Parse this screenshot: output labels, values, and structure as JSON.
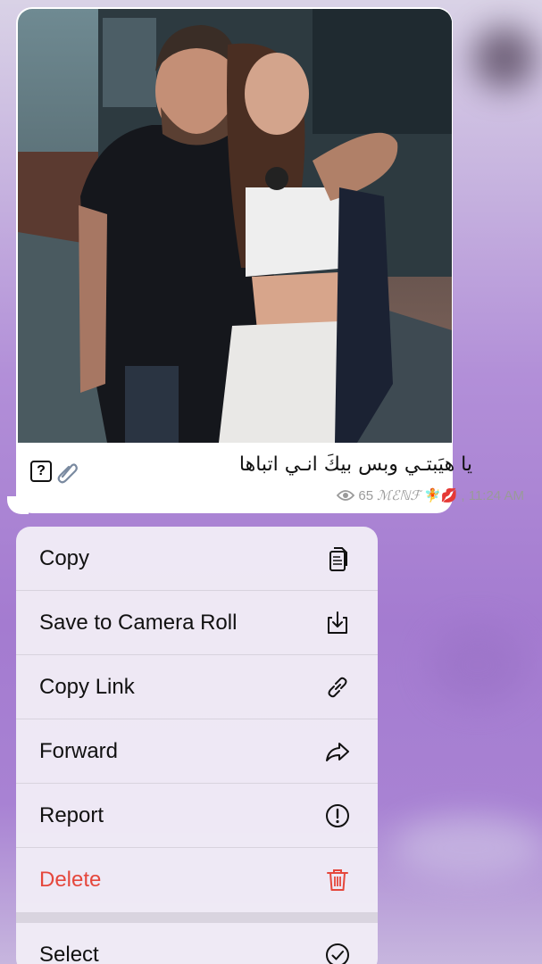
{
  "message": {
    "caption_text": "يا هيَبتـي وبس بيكَ انـي اتباها",
    "caption_extra_box": "?",
    "views": "65",
    "author_signature": "ℳℰℕℱ",
    "signature_emojis": "🧚💋",
    "time": ", 11:24 AM",
    "photo_alt": "photo"
  },
  "context_menu": {
    "items": [
      {
        "label": "Copy",
        "icon": "copy-icon"
      },
      {
        "label": "Save to Camera Roll",
        "icon": "save-icon"
      },
      {
        "label": "Copy Link",
        "icon": "link-icon"
      },
      {
        "label": "Forward",
        "icon": "forward-icon"
      },
      {
        "label": "Report",
        "icon": "report-icon"
      },
      {
        "label": "Delete",
        "icon": "trash-icon"
      },
      {
        "label": "Select",
        "icon": "checkmark-icon"
      }
    ]
  },
  "colors": {
    "danger": "#e5473c",
    "menu_background": "#f0ecf6",
    "chat_background": "#a47bd0"
  }
}
